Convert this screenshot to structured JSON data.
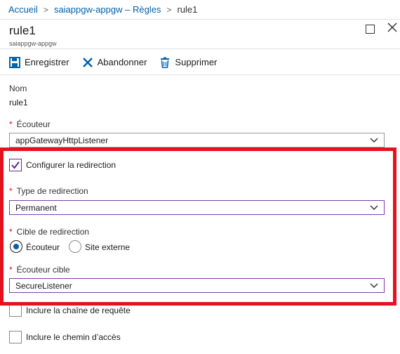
{
  "breadcrumb": {
    "home": "Accueil",
    "parent": "saiappgw-appgw – Règles",
    "current": "rule1",
    "separator": ">"
  },
  "header": {
    "title": "rule1",
    "subtitle": "saiappgw-appgw"
  },
  "toolbar": {
    "save": "Enregistrer",
    "discard": "Abandonner",
    "delete": "Supprimer"
  },
  "form": {
    "name_label": "Nom",
    "name_value": "rule1",
    "listener_label": "Écouteur",
    "listener_value": "appGatewayHttpListener",
    "configure_redirect_label": "Configurer la redirection",
    "configure_redirect_checked": true,
    "redirect_type_label": "Type de redirection",
    "redirect_type_value": "Permanent",
    "redirect_target_label": "Cible de redirection",
    "redirect_target_options": [
      "Écouteur",
      "Site externe"
    ],
    "redirect_target_selected": "Écouteur",
    "target_listener_label": "Écouteur cible",
    "target_listener_value": "SecureListener",
    "include_query_label": "Inclure la chaîne de requête",
    "include_path_label": "Inclure le chemin d’accès",
    "required_marker": "*"
  },
  "colors": {
    "link": "#0062ad",
    "highlight": "#e3121d",
    "required": "#e00b1c",
    "focus_border": "#7e3ea6"
  }
}
